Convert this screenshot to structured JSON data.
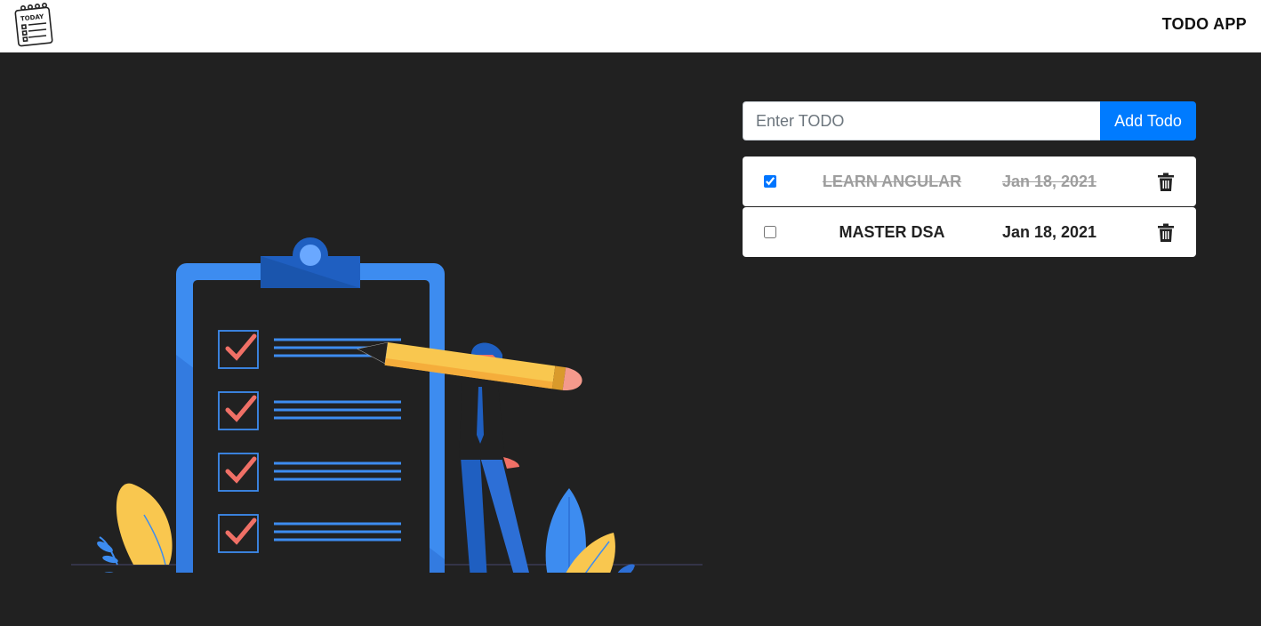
{
  "navbar": {
    "logo_text": "TODAY",
    "brand": "TODO APP"
  },
  "form": {
    "placeholder": "Enter TODO",
    "value": "",
    "add_label": "Add Todo"
  },
  "todos": [
    {
      "title": "LEARN ANGULAR",
      "date": "Jan 18, 2021",
      "completed": true
    },
    {
      "title": "MASTER DSA",
      "date": "Jan 18, 2021",
      "completed": false
    }
  ],
  "colors": {
    "background": "#212121",
    "navbar": "#ffffff",
    "accent": "#007bff",
    "completed_text": "#9e9e9e",
    "clipboard": "#3d8cf0",
    "check": "#f07066",
    "pencil": "#f9c74f",
    "leaf_yellow": "#f9c74f",
    "leaf_blue": "#3d8cf0"
  },
  "icons": {
    "logo": "notepad-icon",
    "delete": "trash-icon",
    "checkbox": "checkbox"
  }
}
